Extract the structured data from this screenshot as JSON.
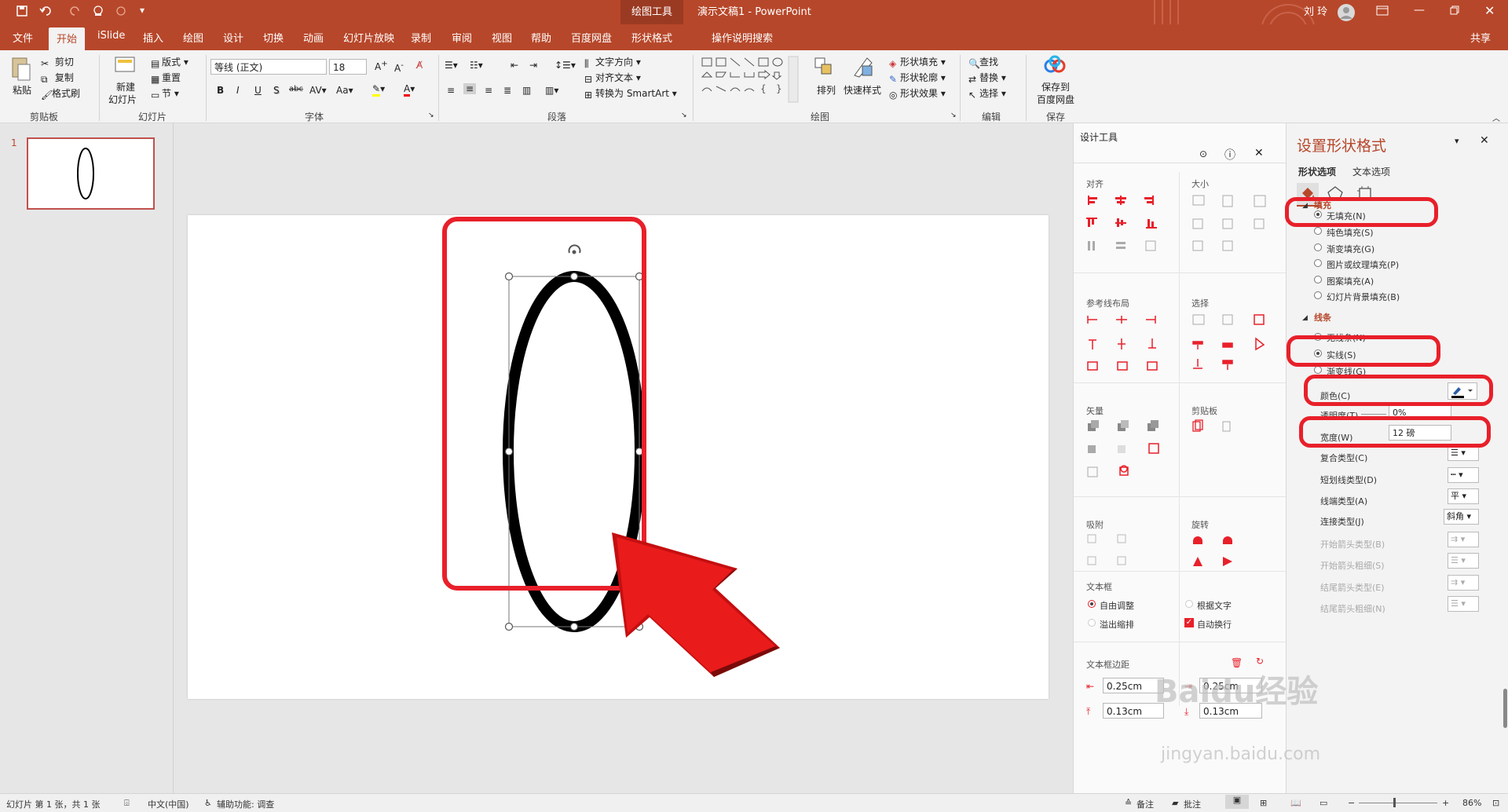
{
  "titlebar": {
    "context_tab": "绘图工具",
    "doc_title": "演示文稿1 - PowerPoint",
    "user": "刘 玲",
    "qa_icons": [
      "save-icon",
      "undo-icon",
      "redo-icon",
      "touch-mode-icon",
      "customize-icon"
    ]
  },
  "tabs": [
    "文件",
    "开始",
    "iSlide",
    "插入",
    "绘图",
    "设计",
    "切换",
    "动画",
    "幻灯片放映",
    "录制",
    "审阅",
    "视图",
    "帮助",
    "百度网盘",
    "形状格式"
  ],
  "active_tab": "开始",
  "tell_me": "操作说明搜索",
  "share": "共享",
  "ribbon": {
    "clipboard": {
      "paste": "粘贴",
      "cut": "剪切",
      "copy": "复制",
      "painter": "格式刷",
      "label": "剪贴板"
    },
    "slides": {
      "new": "新建",
      "new2": "幻灯片",
      "layout": "版式",
      "reset": "重置",
      "section": "节",
      "label": "幻灯片"
    },
    "font": {
      "name": "等线 (正文)",
      "size": "18",
      "label": "字体",
      "bold": "B",
      "italic": "I",
      "underline": "U",
      "shadow": "S",
      "strike": "abc"
    },
    "paragraph": {
      "text_dir": "文字方向",
      "align_text": "对齐文本",
      "smartart": "转换为 SmartArt",
      "label": "段落"
    },
    "drawing": {
      "arrange": "排列",
      "quick_styles": "快速样式",
      "fill": "形状填充",
      "outline": "形状轮廓",
      "effects": "形状效果",
      "label": "绘图"
    },
    "editing": {
      "find": "查找",
      "replace": "替换",
      "select": "选择",
      "label": "编辑"
    },
    "save": {
      "line1": "保存到",
      "line2": "百度网盘",
      "label": "保存"
    }
  },
  "thumbnail": {
    "number": "1"
  },
  "design_tools": {
    "title": "设计工具",
    "sections": {
      "align": "对齐",
      "size": "大小",
      "guides": "参考线布局",
      "select": "选择",
      "vector": "矢量",
      "clipboard": "剪贴板",
      "snap": "吸附",
      "rotate": "旋转",
      "textbox": "文本框",
      "margins": "文本框边距"
    },
    "textbox_opts": {
      "autofit": "自由调整",
      "overflow": "溢出缩排",
      "shrink": "根据文字",
      "wrap": "自动换行"
    },
    "margins": {
      "left": "0.25cm",
      "right": "0.25cm",
      "top": "0.13cm",
      "bottom": "0.13cm"
    }
  },
  "format_pane": {
    "title": "设置形状格式",
    "tab_shape": "形状选项",
    "tab_text": "文本选项",
    "fill_header": "填充",
    "fill_options": [
      "无填充(N)",
      "纯色填充(S)",
      "渐变填充(G)",
      "图片或纹理填充(P)",
      "图案填充(A)",
      "幻灯片背景填充(B)"
    ],
    "line_header": "线条",
    "line_options": [
      "无线条(N)",
      "实线(S)",
      "渐变线(G)"
    ],
    "color_label": "颜色(C)",
    "transparency_label": "透明度(T)",
    "transparency_value": "0%",
    "width_label": "宽度(W)",
    "width_value": "12 磅",
    "compound_label": "复合类型(C)",
    "dash_label": "短划线类型(D)",
    "cap_label": "线端类型(A)",
    "cap_value": "平",
    "join_label": "连接类型(J)",
    "join_value": "斜角",
    "begin_arrow_type": "开始箭头类型(B)",
    "begin_arrow_size": "开始箭头粗细(S)",
    "end_arrow_type": "结尾箭头类型(E)",
    "end_arrow_size": "结尾箭头粗细(N)"
  },
  "statusbar": {
    "slide_info": "幻灯片 第 1 张，共 1 张",
    "language": "中文(中国)",
    "accessibility": "辅助功能: 调查",
    "notes": "备注",
    "comments": "批注",
    "zoom": "86%"
  },
  "watermark": {
    "line1": "Baidu经验",
    "line2": "jingyan.baidu.com"
  },
  "colors": {
    "accent": "#b7472a",
    "highlight": "#e8202a"
  }
}
